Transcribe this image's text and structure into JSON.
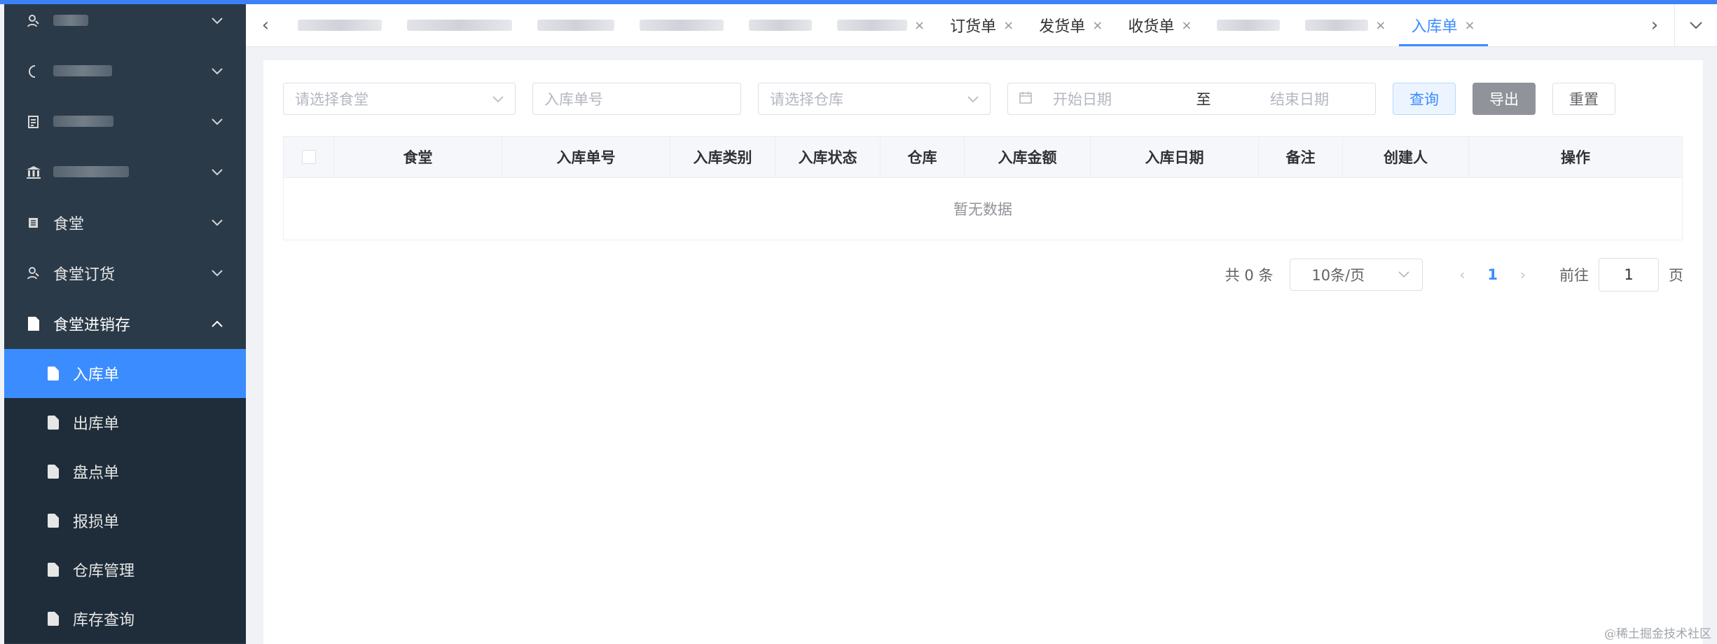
{
  "sidebar": {
    "groups": [
      {
        "label": "",
        "icon": "user-group-icon",
        "expanded": false
      },
      {
        "label": "",
        "icon": "circle-icon",
        "expanded": false
      },
      {
        "label": "",
        "icon": "clipboard-icon",
        "expanded": false
      },
      {
        "label": "",
        "icon": "bank-icon",
        "expanded": false
      },
      {
        "label": "食堂",
        "icon": "list-icon",
        "expanded": false
      },
      {
        "label": "食堂订货",
        "icon": "user-group-icon",
        "expanded": false
      },
      {
        "label": "食堂进销存",
        "icon": "document-icon",
        "expanded": true
      }
    ],
    "sub_items": [
      {
        "label": "入库单",
        "active": true
      },
      {
        "label": "出库单",
        "active": false
      },
      {
        "label": "盘点单",
        "active": false
      },
      {
        "label": "报损单",
        "active": false
      },
      {
        "label": "仓库管理",
        "active": false
      },
      {
        "label": "库存查询",
        "active": false
      }
    ]
  },
  "tabs": {
    "items": [
      {
        "label": "订货单",
        "closable": true,
        "active": false
      },
      {
        "label": "发货单",
        "closable": true,
        "active": false
      },
      {
        "label": "收货单",
        "closable": true,
        "active": false
      },
      {
        "label": "入库单",
        "closable": true,
        "active": true
      }
    ],
    "close_glyph": "×"
  },
  "filters": {
    "canteen_placeholder": "请选择食堂",
    "order_no_placeholder": "入库单号",
    "warehouse_placeholder": "请选择仓库",
    "start_date_placeholder": "开始日期",
    "date_separator": "至",
    "end_date_placeholder": "结束日期",
    "query_label": "查询",
    "export_label": "导出",
    "reset_label": "重置"
  },
  "table": {
    "columns": [
      "食堂",
      "入库单号",
      "入库类别",
      "入库状态",
      "仓库",
      "入库金额",
      "入库日期",
      "备注",
      "创建人",
      "操作"
    ],
    "empty_text": "暂无数据"
  },
  "pagination": {
    "total_text": "共 0 条",
    "page_size": "10条/页",
    "current_page": "1",
    "goto_label": "前往",
    "goto_value": "1",
    "page_suffix": "页"
  },
  "watermark": "@稀土掘金技术社区",
  "colors": {
    "primary": "#3b8cff",
    "sidebar_bg": "#2b3a48",
    "topbar": "#3b82f6"
  }
}
